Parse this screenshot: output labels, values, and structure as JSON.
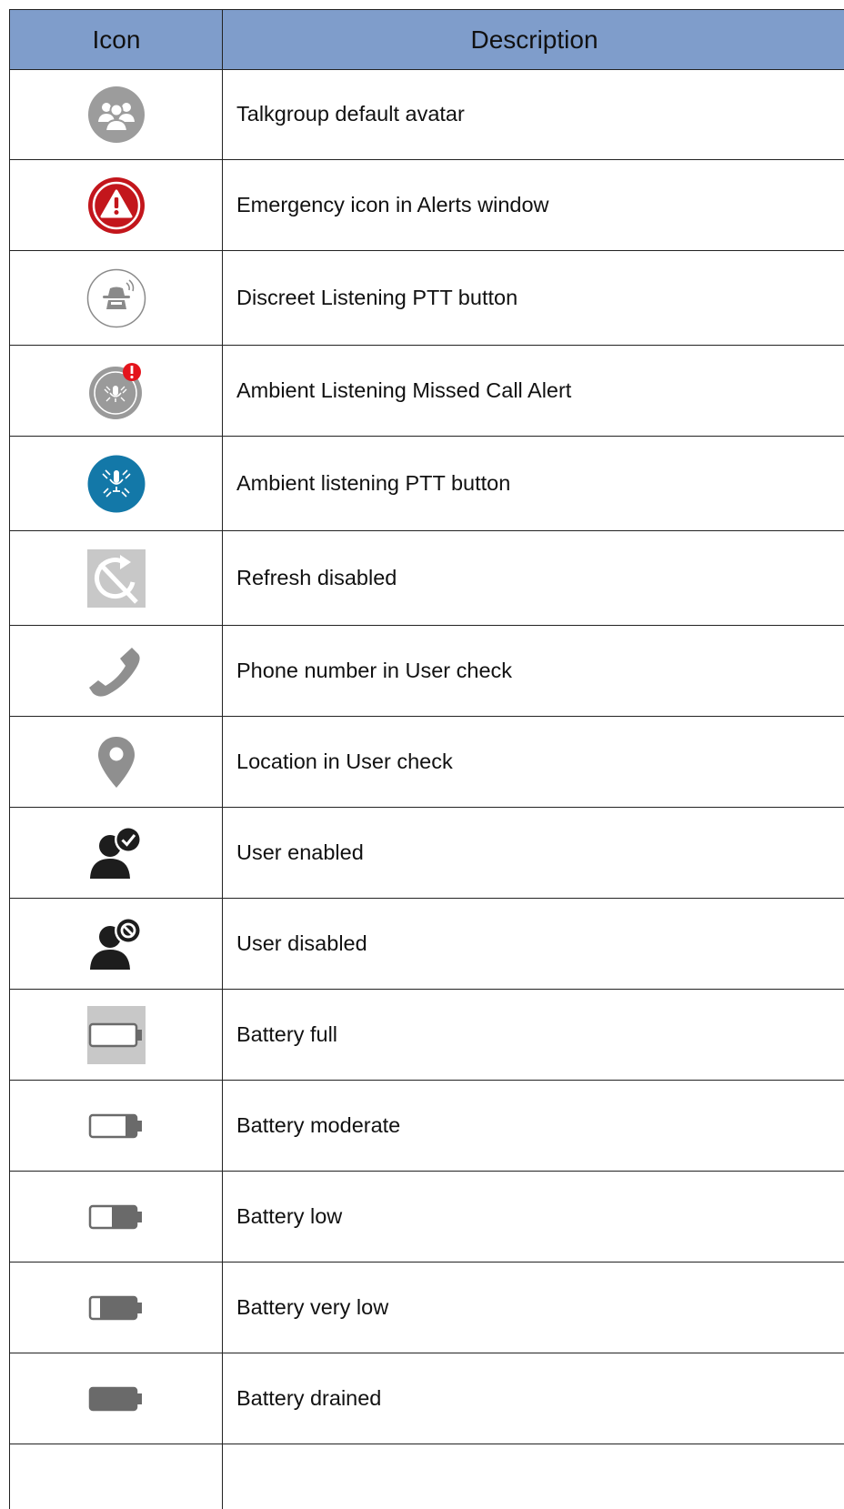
{
  "table": {
    "headers": {
      "icon": "Icon",
      "description": "Description"
    },
    "rows": [
      {
        "icon": "talkgroup-avatar-icon",
        "description": "Talkgroup default avatar"
      },
      {
        "icon": "emergency-alert-icon",
        "description": "Emergency icon in Alerts window"
      },
      {
        "icon": "discreet-listening-icon",
        "description": "Discreet Listening PTT button"
      },
      {
        "icon": "ambient-missed-call-icon",
        "description": "Ambient Listening Missed Call Alert"
      },
      {
        "icon": "ambient-listening-icon",
        "description": "Ambient listening PTT button"
      },
      {
        "icon": "refresh-disabled-icon",
        "description": "Refresh disabled"
      },
      {
        "icon": "phone-icon",
        "description": "Phone number in User check"
      },
      {
        "icon": "location-pin-icon",
        "description": "Location in User check"
      },
      {
        "icon": "user-enabled-icon",
        "description": "User enabled"
      },
      {
        "icon": "user-disabled-icon",
        "description": "User disabled"
      },
      {
        "icon": "battery-full-icon",
        "description": "Battery full"
      },
      {
        "icon": "battery-moderate-icon",
        "description": "Battery moderate"
      },
      {
        "icon": "battery-low-icon",
        "description": "Battery low"
      },
      {
        "icon": "battery-very-low-icon",
        "description": "Battery very low"
      },
      {
        "icon": "battery-drained-icon",
        "description": "Battery drained"
      }
    ]
  }
}
